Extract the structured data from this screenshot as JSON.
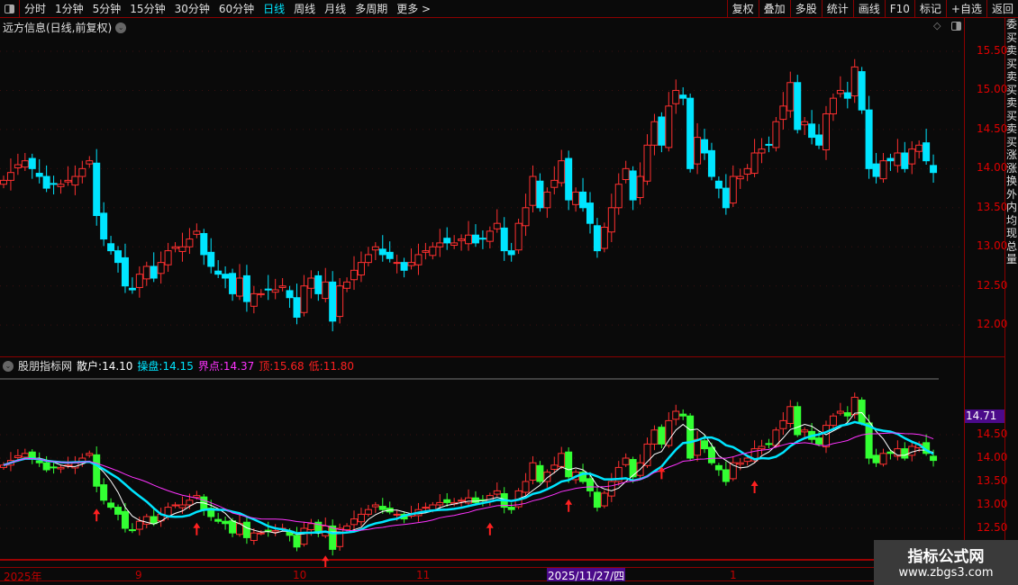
{
  "toolbar": {
    "periods": [
      "分时",
      "1分钟",
      "5分钟",
      "15分钟",
      "30分钟",
      "60分钟",
      "日线",
      "周线",
      "月线",
      "多周期",
      "更多 >"
    ],
    "active_period": "日线",
    "right_buttons": [
      "复权",
      "叠加",
      "多股",
      "统计",
      "画线",
      "F10",
      "标记",
      "+自选",
      "返回"
    ]
  },
  "main": {
    "title": "远方信息(日线,前复权)",
    "price_ticks": [
      "15.50",
      "15.00",
      "14.50",
      "14.00",
      "13.50",
      "13.00",
      "12.50",
      "12.00"
    ]
  },
  "indicator": {
    "name": "股朋指标网",
    "items": [
      {
        "label": "散户:",
        "value": "14.10",
        "color": "#ffffff"
      },
      {
        "label": "操盘:",
        "value": "14.15",
        "color": "#00e5ff"
      },
      {
        "label": "界点:",
        "value": "14.37",
        "color": "#ff33ff"
      },
      {
        "label": "顶:",
        "value": "15.68",
        "color": "#ff2020"
      },
      {
        "label": "低:",
        "value": "11.80",
        "color": "#ff2020"
      }
    ],
    "price_ticks": [
      "14.50",
      "14.00",
      "13.50",
      "13.00",
      "12.50"
    ],
    "cursor_value": "14.71"
  },
  "time_axis": {
    "labels": [
      "2025年",
      "9",
      "10",
      "11",
      "1"
    ],
    "selected": "2025/11/27/四"
  },
  "right_strip": "委买卖买卖买卖买卖买涨涨换外内均现总量",
  "watermark": {
    "title": "指标公式网",
    "url": "www.zbgs3.com"
  },
  "colors": {
    "up": "#ff3030",
    "down": "#00e5ff",
    "lower_up": "#ff3030",
    "lower_down": "#33ff33",
    "ma_fast": "#ffffff",
    "ma_mid": "#00e5ff",
    "ma_slow": "#ff33ff"
  },
  "chart_data": {
    "type": "candlestick",
    "closes": [
      13.85,
      13.95,
      14.05,
      14.1,
      14.0,
      13.9,
      13.75,
      13.8,
      13.8,
      13.85,
      13.9,
      14.0,
      14.1,
      13.4,
      13.1,
      12.95,
      12.8,
      12.5,
      12.45,
      12.65,
      12.75,
      12.6,
      12.8,
      12.95,
      13.0,
      13.0,
      13.1,
      13.2,
      12.9,
      12.75,
      12.65,
      12.6,
      12.4,
      12.6,
      12.3,
      12.4,
      12.4,
      12.45,
      12.45,
      12.5,
      12.35,
      12.1,
      12.5,
      12.6,
      12.4,
      12.55,
      12.05,
      12.5,
      12.55,
      12.7,
      12.8,
      12.9,
      13.0,
      12.9,
      12.85,
      12.8,
      12.7,
      12.8,
      12.9,
      12.95,
      13.0,
      13.05,
      13.05,
      13.05,
      13.1,
      13.15,
      13.05,
      13.1,
      13.2,
      13.3,
      12.95,
      12.9,
      13.3,
      13.5,
      13.9,
      13.5,
      13.7,
      13.85,
      14.1,
      13.6,
      13.7,
      13.5,
      13.3,
      12.95,
      13.25,
      13.5,
      13.8,
      14.0,
      13.6,
      13.9,
      14.3,
      14.6,
      14.3,
      14.8,
      15.0,
      14.9,
      14.0,
      14.4,
      14.2,
      13.9,
      13.75,
      13.5,
      13.9,
      13.9,
      14.0,
      14.2,
      14.25,
      14.3,
      14.6,
      14.8,
      15.1,
      14.5,
      14.6,
      14.4,
      14.3,
      14.7,
      14.9,
      15.0,
      14.9,
      15.3,
      14.75,
      14.0,
      13.9,
      14.1,
      14.1,
      14.2,
      14.0,
      14.25,
      14.3,
      14.1,
      13.95
    ],
    "arrow_indices": [
      13,
      27,
      41,
      45,
      68,
      79,
      92,
      105
    ],
    "high": 15.68,
    "low": 11.8
  }
}
